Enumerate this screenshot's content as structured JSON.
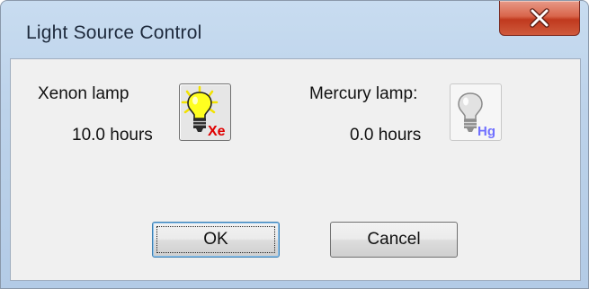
{
  "window": {
    "title": "Light Source Control",
    "close_icon": "close-x-icon"
  },
  "xenon": {
    "name": "Xenon lamp",
    "hours": "10.0 hours",
    "badge": "Xe",
    "badge_color": "#e00000",
    "state": "on",
    "icon": "lit-bulb-icon"
  },
  "mercury": {
    "name": "Mercury lamp:",
    "hours": "0.0 hours",
    "badge": "Hg",
    "badge_color": "#7070ff",
    "state": "off",
    "icon": "unlit-bulb-icon"
  },
  "buttons": {
    "ok_label": "OK",
    "cancel_label": "Cancel"
  }
}
